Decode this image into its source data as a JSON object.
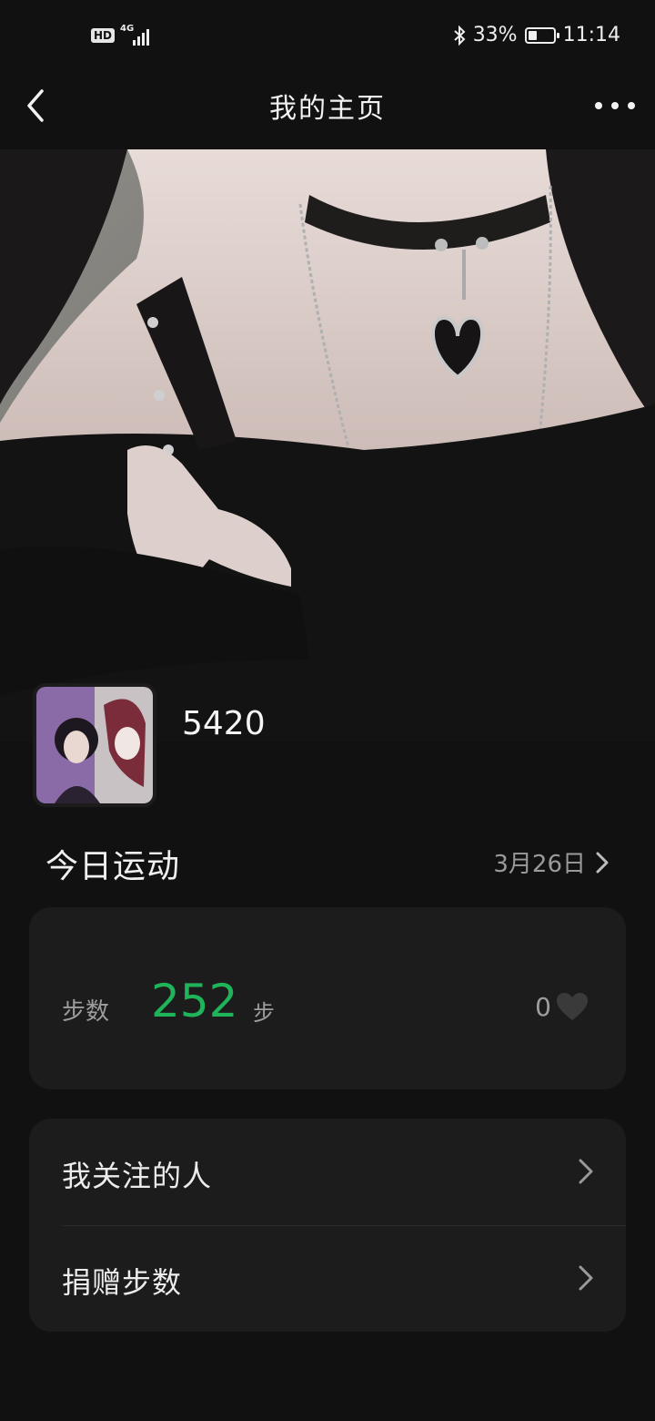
{
  "status_bar": {
    "hd": "HD",
    "network": "4G",
    "battery_percent": "33%",
    "battery_level": 0.33,
    "time": "11:14",
    "icons": [
      "hd-icon",
      "signal-icon",
      "bluetooth-icon",
      "battery-icon"
    ]
  },
  "header": {
    "title": "我的主页",
    "back_icon": "chevron-left-icon",
    "more_icon": "more-dots-icon"
  },
  "profile": {
    "username": "5420"
  },
  "today": {
    "title": "今日运动",
    "date": "3月26日"
  },
  "steps": {
    "label": "步数",
    "value": "252",
    "unit": "步",
    "likes": "0",
    "value_color": "#1fb35a"
  },
  "menu": {
    "items": [
      {
        "label": "我关注的人"
      },
      {
        "label": "捐赠步数"
      }
    ]
  }
}
